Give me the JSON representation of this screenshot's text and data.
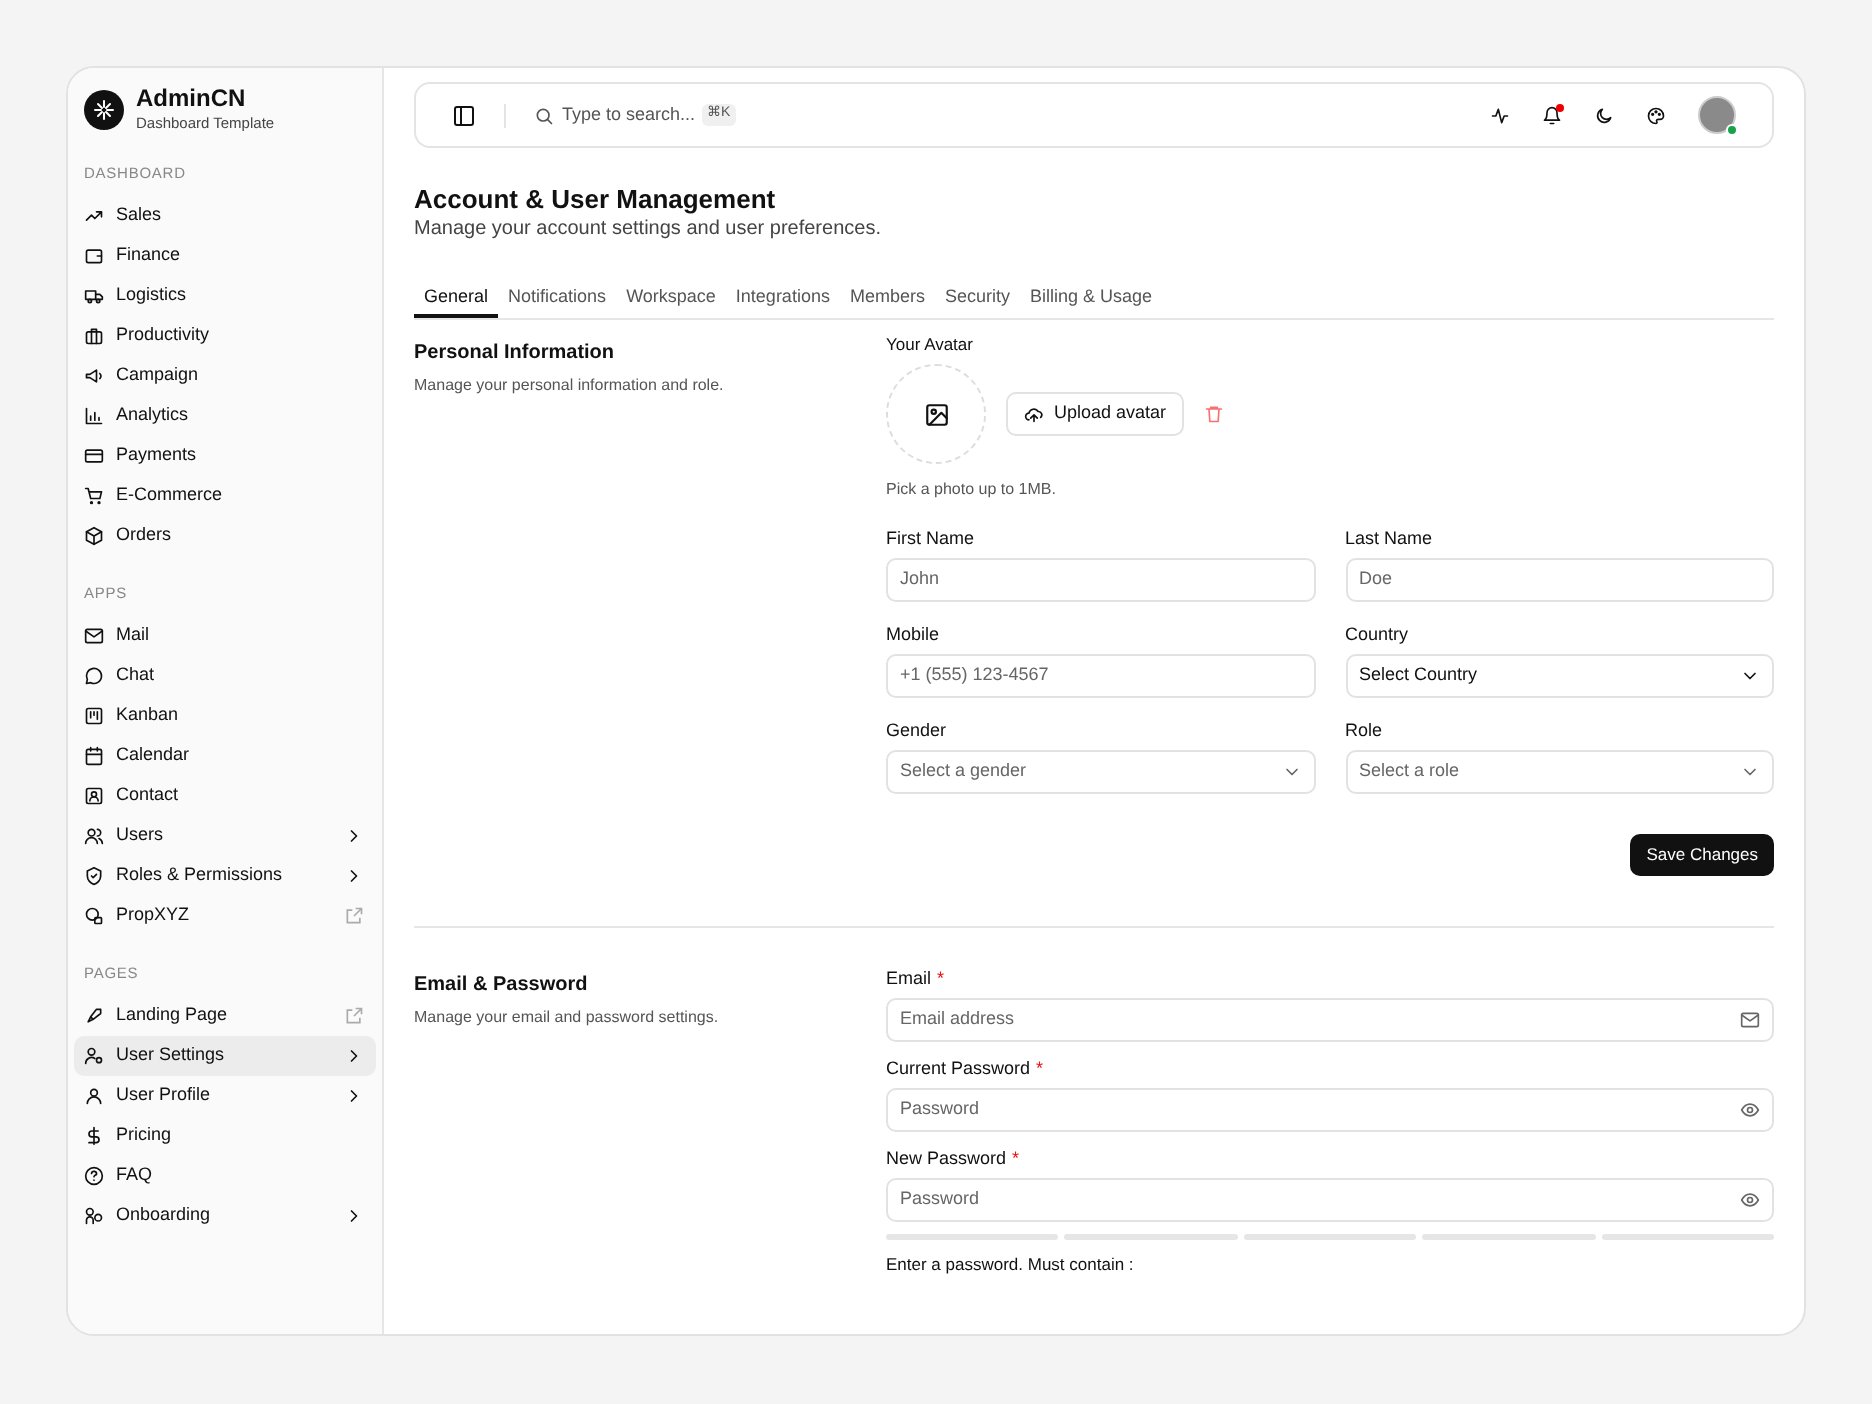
{
  "brand": {
    "name": "AdminCN",
    "subtitle": "Dashboard Template"
  },
  "sidebar": {
    "sections": [
      {
        "title": "DASHBOARD",
        "items": [
          {
            "label": "Sales",
            "kind": "link",
            "selected": false
          },
          {
            "label": "Finance",
            "kind": "link",
            "selected": false
          },
          {
            "label": "Logistics",
            "kind": "link",
            "selected": false
          },
          {
            "label": "Productivity",
            "kind": "link",
            "selected": false
          },
          {
            "label": "Campaign",
            "kind": "link",
            "selected": false
          },
          {
            "label": "Analytics",
            "kind": "link",
            "selected": false
          },
          {
            "label": "Payments",
            "kind": "link",
            "selected": false
          },
          {
            "label": "E-Commerce",
            "kind": "link",
            "selected": false
          },
          {
            "label": "Orders",
            "kind": "link",
            "selected": false
          }
        ]
      },
      {
        "title": "APPS",
        "items": [
          {
            "label": "Mail",
            "kind": "link",
            "selected": false
          },
          {
            "label": "Chat",
            "kind": "link",
            "selected": false
          },
          {
            "label": "Kanban",
            "kind": "link",
            "selected": false
          },
          {
            "label": "Calendar",
            "kind": "link",
            "selected": false
          },
          {
            "label": "Contact",
            "kind": "link",
            "selected": false
          },
          {
            "label": "Users",
            "kind": "submenu",
            "selected": false
          },
          {
            "label": "Roles & Permissions",
            "kind": "submenu",
            "selected": false
          },
          {
            "label": "PropXYZ",
            "kind": "external",
            "selected": false
          }
        ]
      },
      {
        "title": "PAGES",
        "items": [
          {
            "label": "Landing Page",
            "kind": "external",
            "selected": false
          },
          {
            "label": "User Settings",
            "kind": "submenu",
            "selected": true
          },
          {
            "label": "User Profile",
            "kind": "submenu",
            "selected": false
          },
          {
            "label": "Pricing",
            "kind": "link",
            "selected": false
          },
          {
            "label": "FAQ",
            "kind": "link",
            "selected": false
          },
          {
            "label": "Onboarding",
            "kind": "submenu",
            "selected": false
          }
        ]
      }
    ]
  },
  "topbar": {
    "search": {
      "placeholder": "Type to search...",
      "shortcut": "⌘K"
    },
    "notifications_unread": true,
    "user_online": true
  },
  "page": {
    "title": "Account & User Management",
    "subtitle": "Manage your account settings and user preferences."
  },
  "tabs": [
    {
      "label": "General",
      "selected": true
    },
    {
      "label": "Notifications",
      "selected": false
    },
    {
      "label": "Workspace",
      "selected": false
    },
    {
      "label": "Integrations",
      "selected": false
    },
    {
      "label": "Members",
      "selected": false
    },
    {
      "label": "Security",
      "selected": false
    },
    {
      "label": "Billing & Usage",
      "selected": false
    }
  ],
  "personal": {
    "title": "Personal Information",
    "description": "Manage your personal information and role.",
    "avatar_label": "Your Avatar",
    "upload_button": "Upload avatar",
    "avatar_hint": "Pick a photo up to 1MB.",
    "fields": [
      {
        "label": "First Name",
        "kind": "text",
        "placeholder": "John"
      },
      {
        "label": "Last Name",
        "kind": "text",
        "placeholder": "Doe"
      },
      {
        "label": "Mobile",
        "kind": "text",
        "placeholder": "+1 (555) 123-4567"
      },
      {
        "label": "Country",
        "kind": "select",
        "value": "Select Country"
      },
      {
        "label": "Gender",
        "kind": "select",
        "placeholder": "Select a gender"
      },
      {
        "label": "Role",
        "kind": "select",
        "placeholder": "Select a role"
      }
    ],
    "save_button": "Save Changes"
  },
  "security": {
    "title": "Email & Password",
    "description": "Manage your email and password settings.",
    "fields": [
      {
        "label": "Email",
        "required_mark": "*",
        "kind": "email",
        "placeholder": "Email address"
      },
      {
        "label": "Current Password",
        "required_mark": "*",
        "kind": "password",
        "placeholder": "Password"
      },
      {
        "label": "New Password",
        "required_mark": "*",
        "kind": "password",
        "placeholder": "Password"
      }
    ],
    "hint": "Enter a password. Must contain :"
  }
}
